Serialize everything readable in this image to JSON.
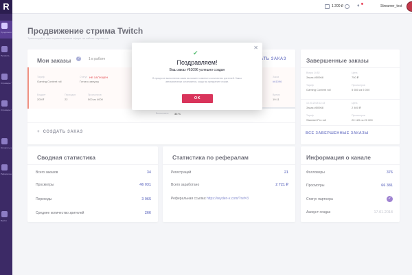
{
  "sidebar": {
    "logo": "R",
    "items": [
      {
        "label": "Продвижение стрима",
        "icon": "dashboard-icon"
      },
      {
        "label": "Профиль",
        "icon": "user-icon"
      },
      {
        "label": "Стримеры Twitch",
        "icon": "twitch-icon"
      },
      {
        "label": "Стримеры YouTube",
        "icon": "youtube-icon"
      },
      {
        "label": "Оплатить заказ",
        "icon": "payment-icon"
      },
      {
        "label": "Реферальная программа",
        "icon": "referral-icon"
      },
      {
        "label": "Выйти",
        "icon": "logout-icon"
      }
    ]
  },
  "topbar": {
    "balance": "1 200 ₽",
    "username": "Streamer_test"
  },
  "page": {
    "title": "Продвижение стрима Twitch",
    "subtitle": "Транслируйте ваш стрим в прямом эфире на сайтах партнеров"
  },
  "orders": {
    "title": "Мои заказы",
    "pending": "1 в работе",
    "create_label_top": "СОЗДАТЬ ЗАКАЗ",
    "create_label": "СОЗДАТЬ ЗАКАЗ",
    "row": {
      "product_label": "Тариф",
      "product": "Gaming Content roll",
      "status_label": "Статус",
      "status": "НЕ ЗАПУЩЕН",
      "status_sub": "Готов к запуску",
      "budget_label": "Бюджет",
      "budget": "200 ₽",
      "period_label": "Периодов",
      "period": "22",
      "views_label": "Просмотров",
      "views": "500 из 4000",
      "order_label": "Заказ",
      "order": "#61096",
      "time_label": "Время",
      "time": "19:11",
      "progress_label": "Выполнено",
      "progress": "33 %"
    }
  },
  "completed": {
    "title": "Завершенные заказы",
    "items": [
      {
        "date": "Вчера 14:52",
        "order": "Заказ #50968",
        "product_label": "Тариф",
        "product": "Gaming Content roll",
        "price_label": "Цена",
        "price": "750 ₽",
        "views_label": "Просмотров",
        "views": "5 650 из 5 000"
      },
      {
        "date": "10.03.2018 12:43",
        "order": "Заказ #50968",
        "product_label": "Тариф",
        "product": "Standart Pro roll",
        "price_label": "Цена",
        "price": "2 400 ₽",
        "views_label": "Просмотров",
        "views": "20 120 из 20 000"
      }
    ],
    "all_label": "ВСЕ ЗАВЕРШЕННЫЕ ЗАКАЗЫ"
  },
  "stats": {
    "title": "Сводная статистика",
    "rows": [
      {
        "label": "Всего заказов",
        "value": "34"
      },
      {
        "label": "Просмотры",
        "value": "46 031"
      },
      {
        "label": "Переходы",
        "value": "3 965"
      },
      {
        "label": "Среднее количество зрителей",
        "value": "266"
      }
    ]
  },
  "referrals": {
    "title": "Статистика по рефералам",
    "rows": [
      {
        "label": "Регистраций",
        "value": "21"
      },
      {
        "label": "Всего заработано",
        "value": "2 721 ₽"
      }
    ],
    "link_label": "Реферальная ссылка:",
    "link": "https://reyden-x.com/?ref=3"
  },
  "channel": {
    "title": "Информация о канале",
    "rows": [
      {
        "label": "Фолловеры",
        "value": "376"
      },
      {
        "label": "Просмотры",
        "value": "66 381"
      },
      {
        "label": "Статус партнера",
        "value": ""
      },
      {
        "label": "Аккаунт создан",
        "value": "17.01.2018"
      }
    ]
  },
  "modal": {
    "title": "Поздравляем!",
    "message": "Ваш заказ #61096 успешно создан",
    "note": "В процессе выполнения заказ вы можете изменить количество зрителей. Заказ автоматически остановится, когда вы прекратите стрим.",
    "button": "OK"
  },
  "colors": {
    "accent": "#3f4bb3",
    "sidebar": "#3c2a66",
    "danger": "#d9345b",
    "success": "#5bbf76"
  }
}
